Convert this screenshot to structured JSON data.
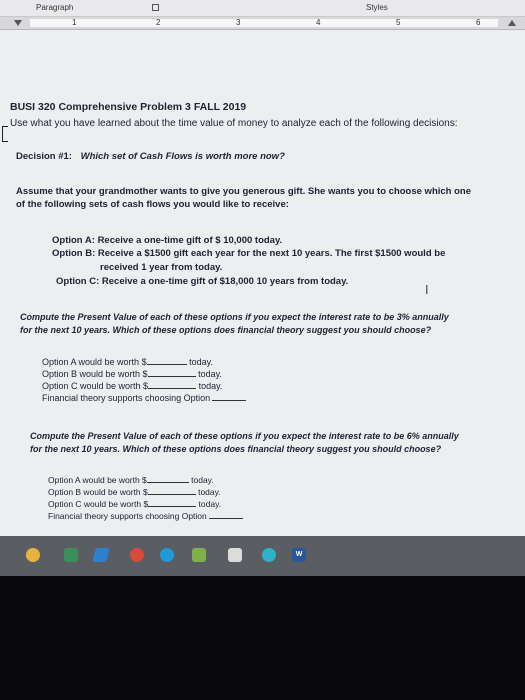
{
  "ribbon": {
    "paragraph_label": "Paragraph",
    "styles_label": "Styles",
    "ruler_numbers": [
      "1",
      "2",
      "3",
      "4",
      "5",
      "6"
    ]
  },
  "doc": {
    "title": "BUSI 320 Comprehensive Problem 3 FALL 2019",
    "intro": "Use what you have learned about the time value of money to analyze each of the following decisions:",
    "decision_label": "Decision #1:",
    "decision_question": "Which set of Cash Flows is worth more now?",
    "assume_line1": "Assume that your grandmother wants to give you generous gift.  She wants you to choose which one",
    "assume_line2": "of the following sets of cash flows you would like to receive:",
    "options": [
      {
        "label": "Option A:",
        "text": "Receive a one-time gift of $ 10,000 today."
      },
      {
        "label": "Option B:",
        "text": "Receive a $1500 gift each year for the next 10 years.  The first $1500 would be"
      },
      {
        "label": "",
        "text": "received 1 year from today."
      },
      {
        "label": "Option C:",
        "text": "Receive a one-time gift of $18,000 10 years from today."
      }
    ],
    "q1_line1": "Compute the Present Value of each of these options if you expect the interest rate to be 3% annually",
    "q1_line2": "for the next 10 years.   Which of these options does financial theory suggest you should choose?",
    "q2_line1": "Compute the Present Value of each of these options if you expect the interest rate to be 6% annually",
    "q2_line2": "for the next 10 years.  Which of these options does financial theory suggest you should choose?",
    "answers": {
      "a_prefix": "Option A would be worth $",
      "b_prefix": "Option B would be worth $",
      "c_prefix": "Option C would be worth $",
      "today": "today.",
      "theory": "Financial theory supports choosing Option"
    }
  },
  "taskbar": {
    "icons": [
      "cortana-icon",
      "file-explorer-icon",
      "pen-icon",
      "chrome-icon",
      "edge-icon",
      "photos-icon",
      "store-icon",
      "media-icon",
      "word-icon"
    ],
    "word_label": "W"
  },
  "colors": {
    "page_bg": "#eceef0",
    "text": "#1e2233",
    "taskbar": "#5a5e63"
  }
}
